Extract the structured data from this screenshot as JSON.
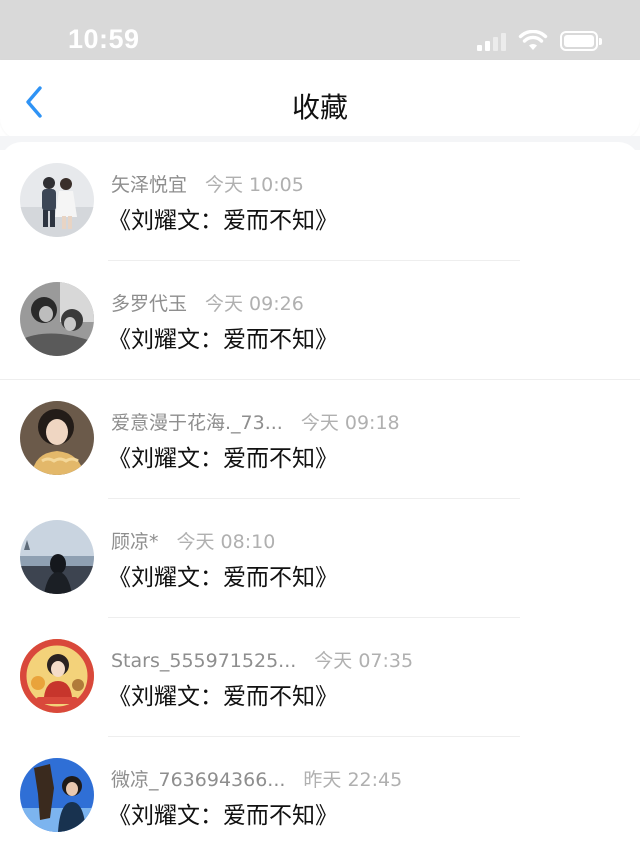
{
  "status_bar": {
    "time": "10:59",
    "icons": [
      "signal-icon",
      "wifi-icon",
      "battery-icon"
    ]
  },
  "nav": {
    "title": "收藏",
    "back_icon": "chevron-left-icon",
    "accent_color": "#2f93f5"
  },
  "favorites": [
    {
      "name": "矢泽悦宜",
      "time": "今天 10:05",
      "title": "《刘耀文：爱而不知》"
    },
    {
      "name": "多罗代玉",
      "time": "今天 09:26",
      "title": "《刘耀文：爱而不知》"
    },
    {
      "name": "爱意漫于花海._73...",
      "time": "今天 09:18",
      "title": "《刘耀文：爱而不知》"
    },
    {
      "name": "顾凉*",
      "time": "今天 08:10",
      "title": "《刘耀文：爱而不知》"
    },
    {
      "name": "Stars_555971525...",
      "time": "今天 07:35",
      "title": "《刘耀文：爱而不知》"
    },
    {
      "name": "微凉_763694366...",
      "time": "昨天 22:45",
      "title": "《刘耀文：爱而不知》"
    }
  ]
}
